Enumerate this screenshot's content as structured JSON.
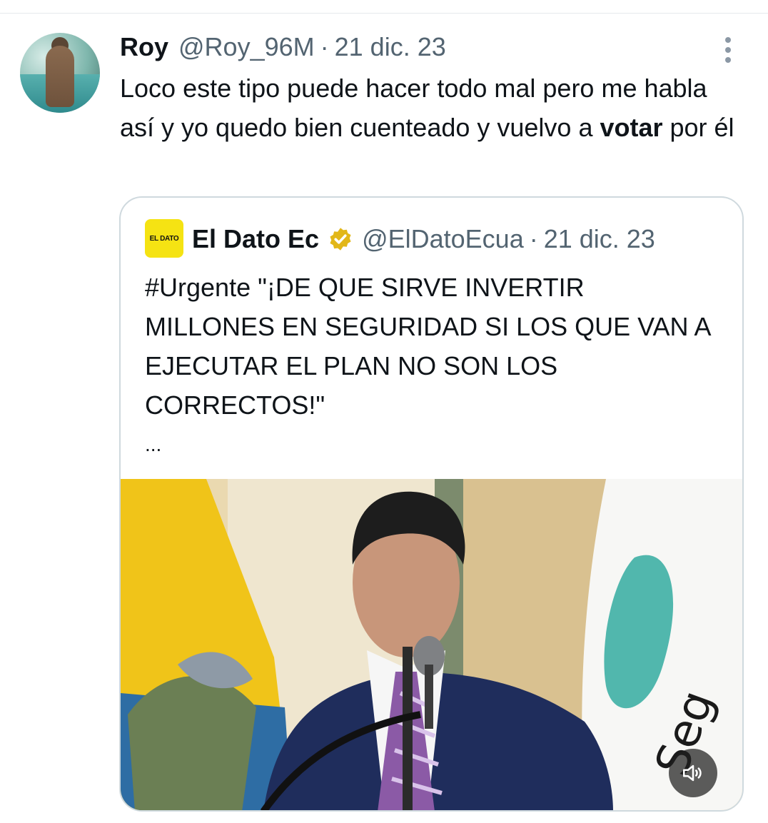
{
  "tweet": {
    "name": "Roy",
    "handle": "@Roy_96M",
    "separator": "·",
    "date": "21 dic. 23",
    "text_before": "Loco este tipo puede hacer todo mal pero me habla así y yo quedo bien cuenteado y vuelvo a ",
    "text_bold": "votar",
    "text_after": " por él"
  },
  "quoted": {
    "logo_text": "EL DATO",
    "name": "El Dato Ec",
    "handle": "@ElDatoEcua",
    "separator": "·",
    "date": "21 dic. 23",
    "text": "#Urgente \"¡DE QUE SIRVE INVERTIR MILLONES EN SEGURIDAD SI LOS QUE VAN A EJECUTAR EL PLAN NO SON LOS CORRECTOS!\"",
    "ellipsis": "...",
    "media": {
      "type": "video",
      "muted_icon": "speaker-muted-icon"
    }
  },
  "colors": {
    "text": "#0f1419",
    "secondary": "#536471",
    "border": "#cfd9de",
    "verified_gold": "#e2b719",
    "logo_yellow": "#f5e313"
  }
}
